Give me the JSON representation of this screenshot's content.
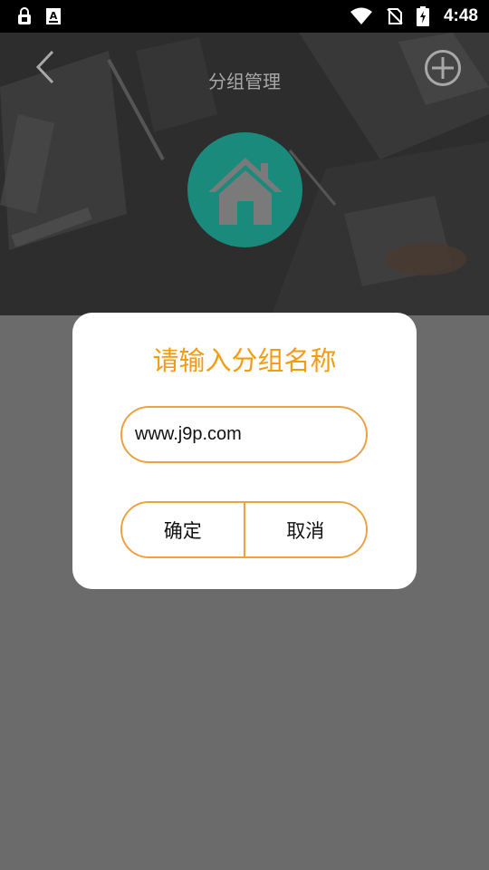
{
  "status_bar": {
    "time": "4:48",
    "icons": [
      "lock-icon",
      "font-a-icon",
      "wifi-icon",
      "no-sim-icon",
      "battery-charging-icon"
    ]
  },
  "header": {
    "title": "分组管理",
    "back_icon": "chevron-left-icon",
    "add_icon": "plus-circle-icon",
    "avatar_icon": "home-icon"
  },
  "dialog": {
    "title": "请输入分组名称",
    "input_value": "www.j9p.com",
    "confirm_label": "确定",
    "cancel_label": "取消"
  },
  "colors": {
    "accent": "#f39c12",
    "border": "#f0a040",
    "avatar_bg": "#1a8a7c",
    "overlay": "#6b6b6b"
  }
}
